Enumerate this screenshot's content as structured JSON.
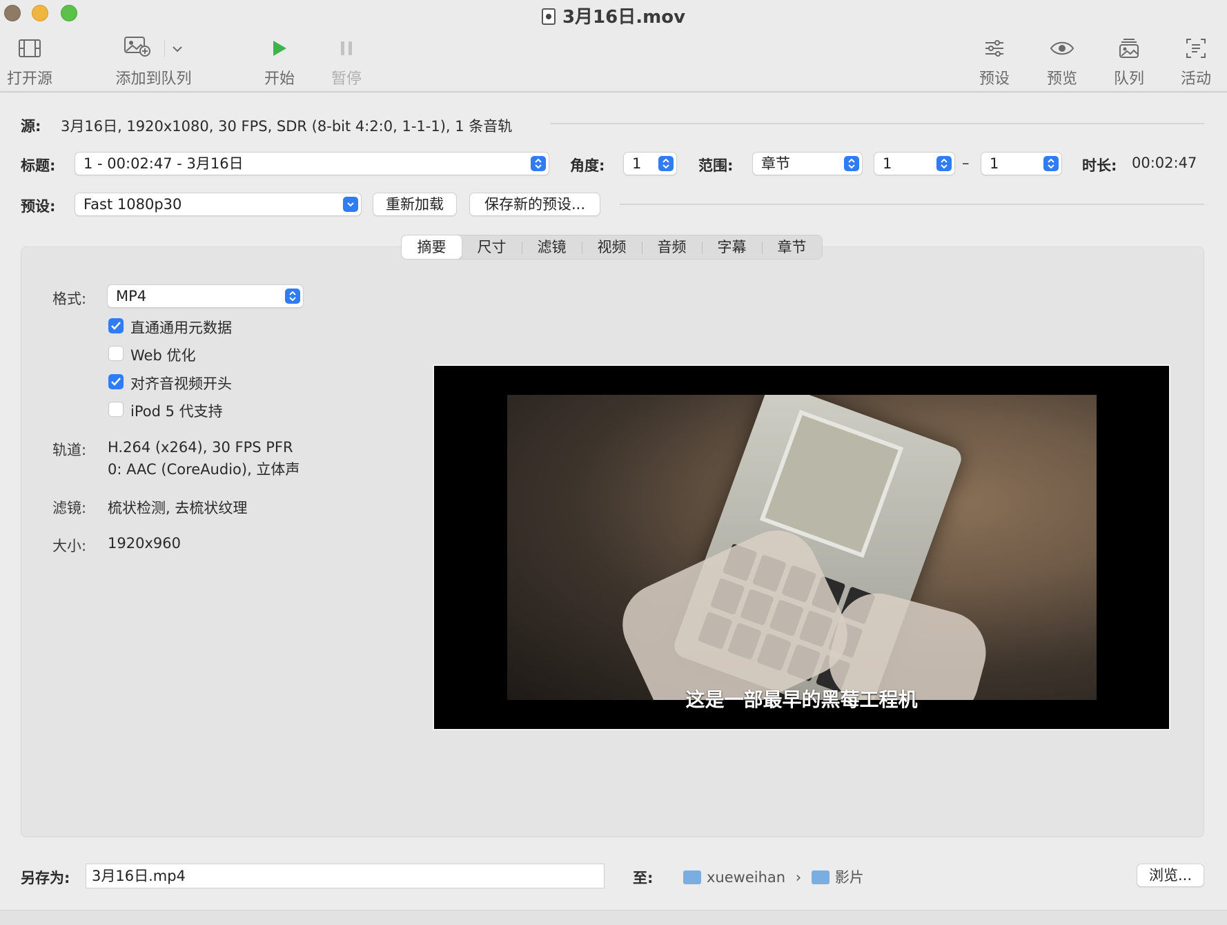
{
  "window": {
    "title": "3月16日.mov"
  },
  "toolbar": {
    "open_source": "打开源",
    "add_to_queue": "添加到队列",
    "start": "开始",
    "pause": "暂停",
    "presets": "预设",
    "preview": "预览",
    "queue": "队列",
    "activity": "活动"
  },
  "source": {
    "label": "源:",
    "value": "3月16日, 1920x1080, 30 FPS, SDR (8-bit 4:2:0, 1-1-1), 1 条音轨"
  },
  "title_row": {
    "title_label": "标题:",
    "title_value": "1 - 00:02:47 - 3月16日",
    "angle_label": "角度:",
    "angle_value": "1",
    "range_label": "范围:",
    "range_type": "章节",
    "range_start": "1",
    "range_dash": "–",
    "range_end": "1",
    "duration_label": "时长:",
    "duration_value": "00:02:47"
  },
  "preset_row": {
    "label": "预设:",
    "value": "Fast 1080p30",
    "reload_button": "重新加载",
    "save_button": "保存新的预设..."
  },
  "tabs": [
    "摘要",
    "尺寸",
    "滤镜",
    "视频",
    "音频",
    "字幕",
    "章节"
  ],
  "active_tab": "摘要",
  "summary": {
    "format_label": "格式:",
    "format_value": "MP4",
    "checkboxes": [
      {
        "label": "直通通用元数据",
        "checked": true
      },
      {
        "label": "Web 优化",
        "checked": false
      },
      {
        "label": "对齐音视频开头",
        "checked": true
      },
      {
        "label": "iPod 5 代支持",
        "checked": false
      }
    ],
    "tracks_label": "轨道:",
    "tracks_line1": "H.264 (x264), 30 FPS PFR",
    "tracks_line2": "0: AAC (CoreAudio), 立体声",
    "filters_label": "滤镜:",
    "filters_value": "梳状检测, 去梳状纹理",
    "size_label": "大小:",
    "size_value": "1920x960"
  },
  "preview": {
    "subtitle": "这是一部最早的黑莓工程机"
  },
  "footer": {
    "save_as_label": "另存为:",
    "save_as_value": "3月16日.mp4",
    "to_label": "至:",
    "path_user": "xueweihan",
    "path_sep": "›",
    "path_folder": "影片",
    "browse_button": "浏览..."
  },
  "colors": {
    "accent": "#2f7cf6",
    "play_green": "#3bb54a"
  }
}
